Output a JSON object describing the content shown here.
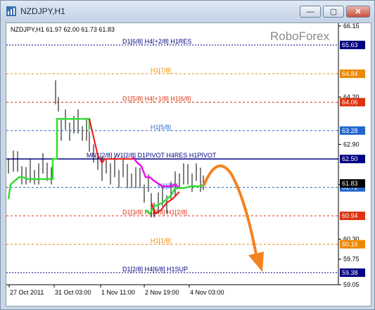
{
  "window": {
    "title": "NZDJPY,H1",
    "buttons": {
      "minimize": "—",
      "maximize": "▢",
      "close": "✕"
    }
  },
  "chart": {
    "header": "NZDJPY,H1  61.97 62.00 61.73 61.83",
    "watermark": "RoboForex",
    "colors": {
      "candles": "#000000",
      "green_line": "#33dd33",
      "red_line": "#ee1111",
      "magenta_line": "#ee11ee",
      "navy_line": "#000080",
      "orange_arrow": "#f58220",
      "label_blue": "#2255aa",
      "label_orange": "#ee8800",
      "label_red": "#dd3311"
    }
  },
  "chart_data": {
    "type": "line",
    "y_ticks": [
      "66.15",
      "64.20",
      "62.90",
      "61.80",
      "60.30",
      "59.75",
      "59.05"
    ],
    "x_ticks": [
      "27 Oct 2011",
      "31 Oct 03:00",
      "1 Nov 11:00",
      "2 Nov 19:00",
      "4 Nov 03:00"
    ],
    "levels": [
      {
        "label": "D1[6/8] H4[+2/8] H1RES",
        "value": 65.63,
        "tag": "65.63",
        "style": "dotted",
        "color": "#000080"
      },
      {
        "label": "H1[7/8]",
        "value": 64.84,
        "tag": "64.84",
        "style": "dashed",
        "color": "#ee8800"
      },
      {
        "label": "D1[5/8] H4[+1/8] H1[6/8]",
        "value": 64.06,
        "tag": "64.06",
        "style": "dashed",
        "color": "#dd3311"
      },
      {
        "label": "H1[5/8]",
        "value": 63.28,
        "tag": "63.28",
        "style": "dashed",
        "color": "#2266cc"
      },
      {
        "label": "MN1[2/8] W1[2/8] D1PIVOT H4RES H1PIVOT",
        "value": 62.5,
        "tag": "62.50",
        "style": "solid",
        "color": "#000080"
      },
      {
        "label": "",
        "value": 61.72,
        "tag": "61.72",
        "style": "dashed",
        "color": "#2266cc"
      },
      {
        "label": "D1[3/8] H4[7/8] H1[2/8]",
        "value": 60.94,
        "tag": "60.94",
        "style": "dashed",
        "color": "#dd3311"
      },
      {
        "label": "H1[1/8]",
        "value": 60.16,
        "tag": "60.16",
        "style": "dashed",
        "color": "#ee8800"
      },
      {
        "label": "D1[2/8] H4[6/8] H1SUP",
        "value": 59.38,
        "tag": "59.38",
        "style": "dotted",
        "color": "#000080"
      }
    ],
    "price_tags": {
      "current_high": "61.83",
      "current_low": "61.72",
      "extra": "61.80"
    },
    "mid_label": "H1[3/8]",
    "ylim": [
      59.05,
      66.15
    ]
  }
}
